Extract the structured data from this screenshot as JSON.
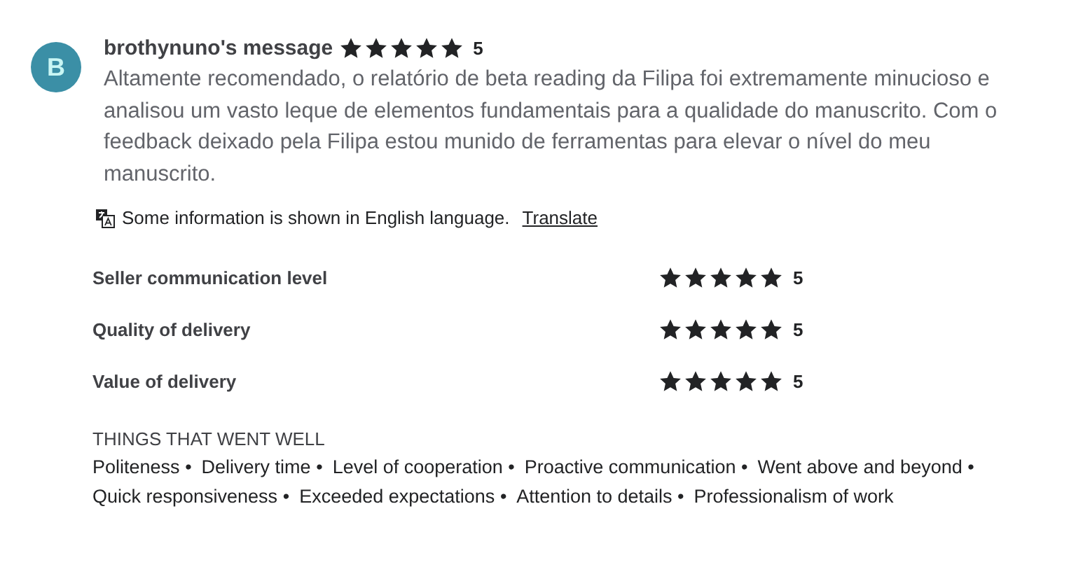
{
  "review": {
    "avatar_letter": "B",
    "author": "brothynuno's message",
    "stars": 5,
    "rating": "5",
    "text": "Altamente recomendado, o relatório de beta reading da Filipa foi extremamente minucioso e analisou um vasto leque de elementos fundamentais para a qualidade do manuscrito. Com o feedback deixado pela Filipa estou munido de ferramentas para elevar o nível do meu manuscrito."
  },
  "translation": {
    "notice": "Some information is shown in English language.",
    "link": "Translate"
  },
  "ratings": [
    {
      "label": "Seller communication level",
      "stars": 5,
      "rating": "5"
    },
    {
      "label": "Quality of delivery",
      "stars": 5,
      "rating": "5"
    },
    {
      "label": "Value of delivery",
      "stars": 5,
      "rating": "5"
    }
  ],
  "highlights": {
    "title": "THINGS THAT WENT WELL",
    "separator": "•",
    "items": [
      "Politeness",
      "Delivery time",
      "Level of cooperation",
      "Proactive communication",
      "Went above and beyond",
      "Quick responsiveness",
      "Exceeded expectations",
      "Attention to details",
      "Professionalism of work"
    ]
  }
}
